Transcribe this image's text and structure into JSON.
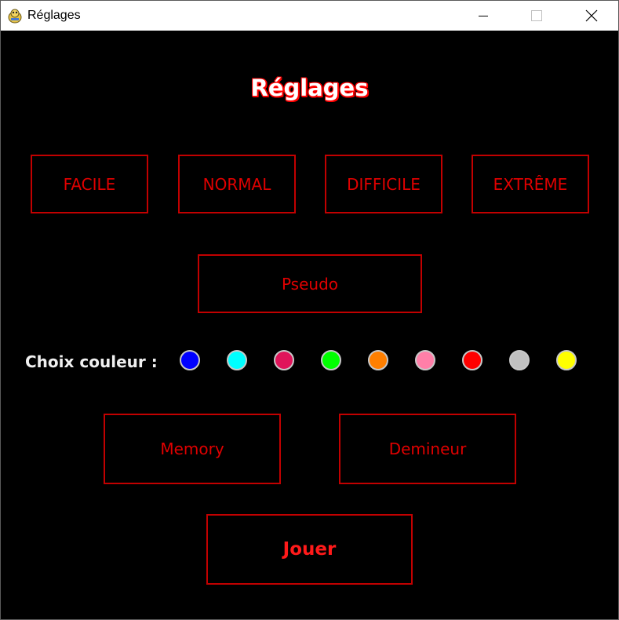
{
  "window": {
    "title": "Réglages"
  },
  "heading": "Réglages",
  "levels": [
    "FACILE",
    "NORMAL",
    "DIFFICILE",
    "EXTRÊME"
  ],
  "pseudo_label": "Pseudo",
  "color_choice": {
    "label": "Choix couleur :",
    "colors": [
      "#0000ff",
      "#00ffff",
      "#e0145a",
      "#00ff00",
      "#ff7f00",
      "#ff7fa8",
      "#ff0000",
      "#c0c0c0",
      "#ffff00"
    ]
  },
  "games": [
    "Memory",
    "Demineur"
  ],
  "play_label": "Jouer"
}
